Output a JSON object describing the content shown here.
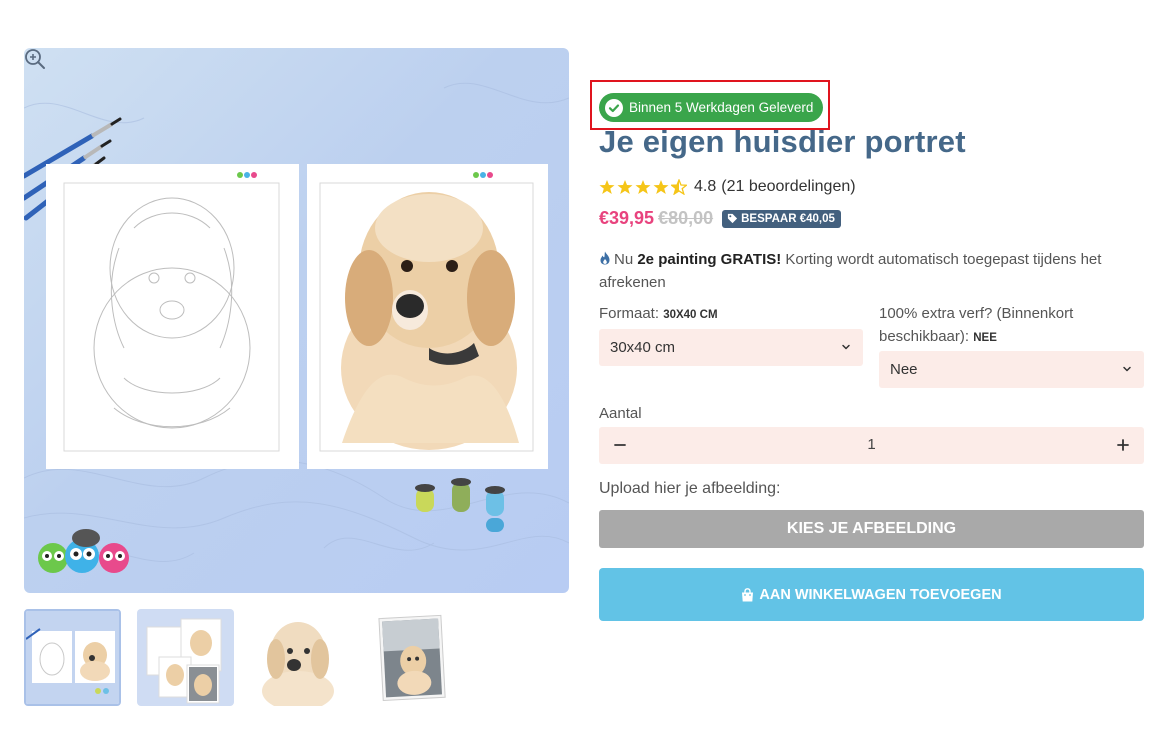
{
  "gallery": {
    "thumbnails": [
      "thumbnail-1",
      "thumbnail-2",
      "thumbnail-3",
      "thumbnail-4"
    ],
    "selected_index": 0
  },
  "product": {
    "delivery_badge": "Binnen 5 Werkdagen Geleverd",
    "title": "Je eigen huisdier portret",
    "rating": {
      "stars": 4.5,
      "score": "4.8",
      "count_text": "(21 beoordelingen)"
    },
    "price": {
      "current": "€39,95",
      "original": "€80,00",
      "save_label": "BESPAAR €40,05"
    },
    "promo": {
      "prefix": "Nu ",
      "bold": "2e painting GRATIS!",
      "suffix": " Korting wordt automatisch toegepast tijdens het afrekenen"
    },
    "format": {
      "label": "Formaat: ",
      "label_value": "30X40 CM",
      "selected": "30x40 cm"
    },
    "extra_paint": {
      "label": "100% extra verf? (Binnenkort beschikbaar): ",
      "label_value": "NEE",
      "selected": "Nee"
    },
    "quantity": {
      "label": "Aantal",
      "value": "1"
    },
    "upload": {
      "label": "Upload hier je afbeelding:",
      "button": "KIES JE AFBEELDING"
    },
    "cart_button": "AAN WINKELWAGEN TOEVOEGEN"
  },
  "colors": {
    "badge_green": "#3aa54b",
    "title_blue": "#456889",
    "price_pink": "#e8437e",
    "star_yellow": "#f5c518",
    "cart_button": "#62c3e6",
    "upload_button": "#a9a9a9",
    "select_bg": "#fcece8",
    "highlight_red": "#e0141e"
  },
  "icons": {
    "badge": "check-circle-icon",
    "save_tag": "tag-icon",
    "promo": "flame-icon",
    "cart": "shopping-bag-icon",
    "zoom": "zoom-in-icon",
    "select": "chevron-down-icon",
    "qty_minus": "minus-icon",
    "qty_plus": "plus-icon"
  }
}
